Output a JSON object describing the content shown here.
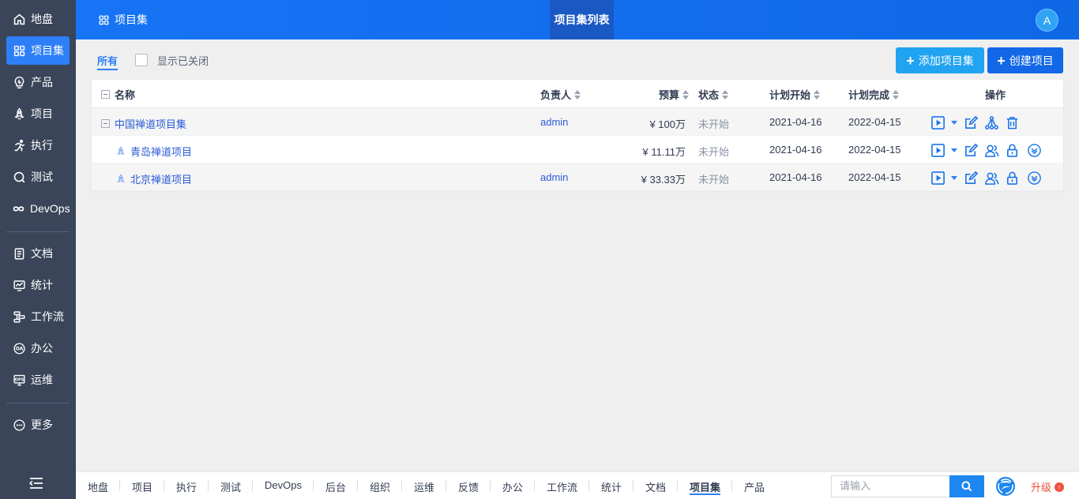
{
  "sidebar": {
    "items": [
      {
        "label": "地盘",
        "icon": "home-icon"
      },
      {
        "label": "项目集",
        "icon": "grid-icon",
        "active": true
      },
      {
        "label": "产品",
        "icon": "bulb-icon"
      },
      {
        "label": "项目",
        "icon": "rocket-icon"
      },
      {
        "label": "执行",
        "icon": "run-icon"
      },
      {
        "label": "测试",
        "icon": "test-icon"
      },
      {
        "label": "DevOps",
        "icon": "infinity-icon"
      },
      {
        "label": "文档",
        "icon": "doc-icon"
      },
      {
        "label": "统计",
        "icon": "chart-icon"
      },
      {
        "label": "工作流",
        "icon": "workflow-icon"
      },
      {
        "label": "办公",
        "icon": "oa-icon"
      },
      {
        "label": "运维",
        "icon": "ops-icon"
      },
      {
        "label": "更多",
        "icon": "more-icon"
      }
    ]
  },
  "header": {
    "crumb": "项目集",
    "tab": "项目集列表",
    "avatar": "A"
  },
  "toolbar": {
    "tab_all": "所有",
    "show_closed": "显示已关闭",
    "add_label": "添加项目集",
    "create_label": "创建项目"
  },
  "table": {
    "columns": {
      "name": "名称",
      "owner": "负责人",
      "budget": "预算",
      "status": "状态",
      "plan_start": "计划开始",
      "plan_end": "计划完成",
      "actions": "操作"
    },
    "rows": [
      {
        "name": "中国禅道项目集",
        "owner": "admin",
        "budget": "¥ 100万",
        "status": "未开始",
        "start": "2021-04-16",
        "end": "2022-04-15",
        "type": "program"
      },
      {
        "name": "青岛禅道项目",
        "owner": "",
        "budget": "¥ 11.11万",
        "status": "未开始",
        "start": "2021-04-16",
        "end": "2022-04-15",
        "type": "project"
      },
      {
        "name": "北京禅道项目",
        "owner": "admin",
        "budget": "¥ 33.33万",
        "status": "未开始",
        "start": "2021-04-16",
        "end": "2022-04-15",
        "type": "project"
      }
    ]
  },
  "footer": {
    "nav": [
      "地盘",
      "项目",
      "执行",
      "测试",
      "DevOps",
      "后台",
      "组织",
      "运维",
      "反馈",
      "办公",
      "工作流",
      "统计",
      "文档",
      "项目集",
      "产品"
    ],
    "active": "项目集",
    "search_placeholder": "请输入",
    "upgrade": "升级"
  },
  "colors": {
    "accent": "#2e7ff7",
    "sidebar_bg": "#3a4559",
    "header_bg": "#1774f5",
    "add_button": "#20a3f0",
    "create_button": "#1268e6",
    "upgrade": "#f0513e"
  }
}
